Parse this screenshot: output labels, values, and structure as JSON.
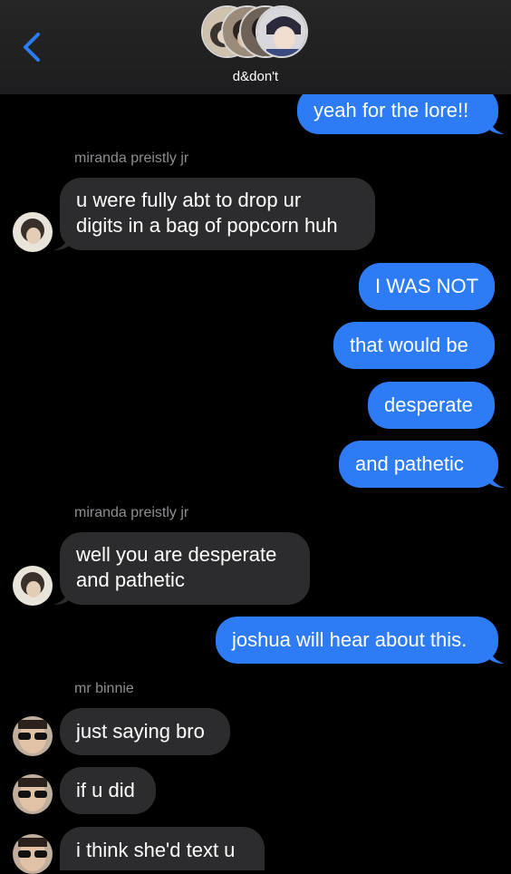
{
  "header": {
    "group_name": "d&don't"
  },
  "messages": {
    "m0": "yeah for the lore!!",
    "s1": "miranda preistly jr",
    "m1_l1": "u were fully abt to drop ur",
    "m1_l2": "digits in a bag of popcorn huh",
    "m2": "I WAS NOT",
    "m3": "that would be",
    "m4": "desperate",
    "m5": "and pathetic",
    "s2": "miranda preistly jr",
    "m6_l1": "well you are desperate",
    "m6_l2": "and pathetic",
    "m7": "joshua will hear about this.",
    "s3": "mr binnie",
    "m8": "just saying bro",
    "m9": "if u did",
    "m10": "i think she'd text u"
  },
  "colors": {
    "outgoing_bubble": "#2d7cf6",
    "incoming_bubble": "#2c2c2e",
    "background": "#000000",
    "back_chevron": "#2d7cf6"
  }
}
